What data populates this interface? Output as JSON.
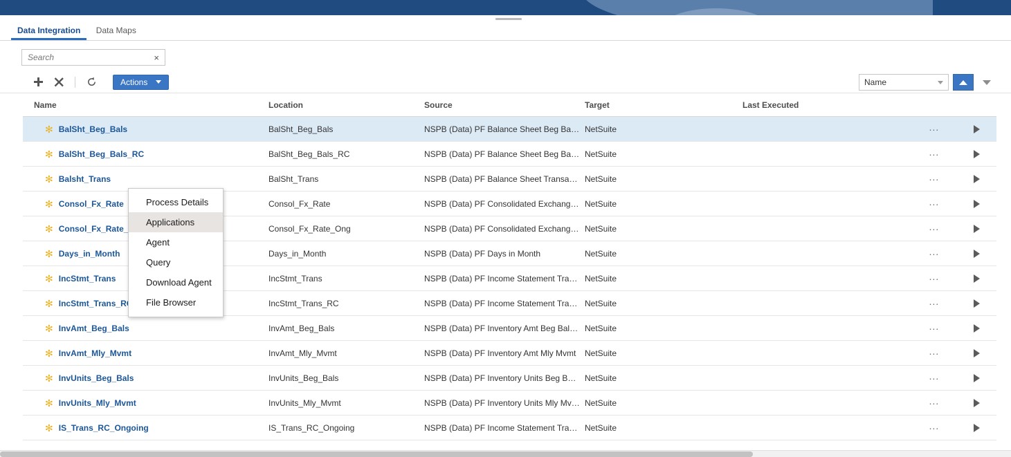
{
  "header": {
    "bar_color": "#1f4b80",
    "accent_color": "#3a76c4",
    "drag_handle": "drag-handle"
  },
  "tabs": [
    {
      "label": "Data Integration",
      "active": true
    },
    {
      "label": "Data Maps",
      "active": false
    }
  ],
  "search": {
    "value": "",
    "placeholder": "Search",
    "clear_label": "×"
  },
  "toolbar": {
    "add_label": "+",
    "delete_label": "✕",
    "refresh_label": "↺",
    "actions_label": "Actions",
    "sort_field": "Name",
    "sort_asc_label": "▲",
    "sort_desc_label": "▼"
  },
  "actions_menu": {
    "items": [
      {
        "label": "Process Details",
        "highlighted": false
      },
      {
        "label": "Applications",
        "highlighted": true
      },
      {
        "label": "Agent",
        "highlighted": false
      },
      {
        "label": "Query",
        "highlighted": false
      },
      {
        "label": "Download Agent",
        "highlighted": false
      },
      {
        "label": "File Browser",
        "highlighted": false
      }
    ]
  },
  "table": {
    "columns": [
      "Name",
      "Location",
      "Source",
      "Target",
      "Last Executed"
    ],
    "row_menu_label": "∙∙∙",
    "rows": [
      {
        "name": "BalSht_Beg_Bals",
        "location": "BalSht_Beg_Bals",
        "source": "NSPB (Data) PF Balance Sheet Beg Balances",
        "target": "NetSuite",
        "last_executed": "",
        "selected": true
      },
      {
        "name": "BalSht_Beg_Bals_RC",
        "location": "BalSht_Beg_Bals_RC",
        "source": "NSPB (Data) PF Balance Sheet Beg Balances - R…",
        "target": "NetSuite",
        "last_executed": "",
        "selected": false
      },
      {
        "name": "Balsht_Trans",
        "location": "BalSht_Trans",
        "source": "NSPB (Data) PF Balance Sheet Transactions",
        "target": "NetSuite",
        "last_executed": "",
        "selected": false
      },
      {
        "name": "Consol_Fx_Rate",
        "location": "Consol_Fx_Rate",
        "source": "NSPB (Data) PF Consolidated Exchange Rates",
        "target": "NetSuite",
        "last_executed": "",
        "selected": false
      },
      {
        "name": "Consol_Fx_Rate_Ong",
        "location": "Consol_Fx_Rate_Ong",
        "source": "NSPB (Data) PF Consolidated Exchange Rates",
        "target": "NetSuite",
        "last_executed": "",
        "selected": false
      },
      {
        "name": "Days_in_Month",
        "location": "Days_in_Month",
        "source": "NSPB (Data) PF Days in Month",
        "target": "NetSuite",
        "last_executed": "",
        "selected": false
      },
      {
        "name": "IncStmt_Trans",
        "location": "IncStmt_Trans",
        "source": "NSPB (Data) PF Income Statement Transactions",
        "target": "NetSuite",
        "last_executed": "",
        "selected": false
      },
      {
        "name": "IncStmt_Trans_RC",
        "location": "IncStmt_Trans_RC",
        "source": "NSPB (Data) PF Income Statement Transactions - …",
        "target": "NetSuite",
        "last_executed": "",
        "selected": false
      },
      {
        "name": "InvAmt_Beg_Bals",
        "location": "InvAmt_Beg_Bals",
        "source": "NSPB (Data) PF Inventory Amt Beg Balances",
        "target": "NetSuite",
        "last_executed": "",
        "selected": false
      },
      {
        "name": "InvAmt_Mly_Mvmt",
        "location": "InvAmt_Mly_Mvmt",
        "source": "NSPB (Data) PF Inventory Amt Mly Mvmt",
        "target": "NetSuite",
        "last_executed": "",
        "selected": false
      },
      {
        "name": "InvUnits_Beg_Bals",
        "location": "InvUnits_Beg_Bals",
        "source": "NSPB (Data) PF Inventory Units Beg Balances",
        "target": "NetSuite",
        "last_executed": "",
        "selected": false
      },
      {
        "name": "InvUnits_Mly_Mvmt",
        "location": "InvUnits_Mly_Mvmt",
        "source": "NSPB (Data) PF Inventory Units Mly Mvmt",
        "target": "NetSuite",
        "last_executed": "",
        "selected": false
      },
      {
        "name": "IS_Trans_RC_Ongoing",
        "location": "IS_Trans_RC_Ongoing",
        "source": "NSPB (Data) PF Income Statement Transactions - …",
        "target": "NetSuite",
        "last_executed": "",
        "selected": false
      }
    ]
  }
}
